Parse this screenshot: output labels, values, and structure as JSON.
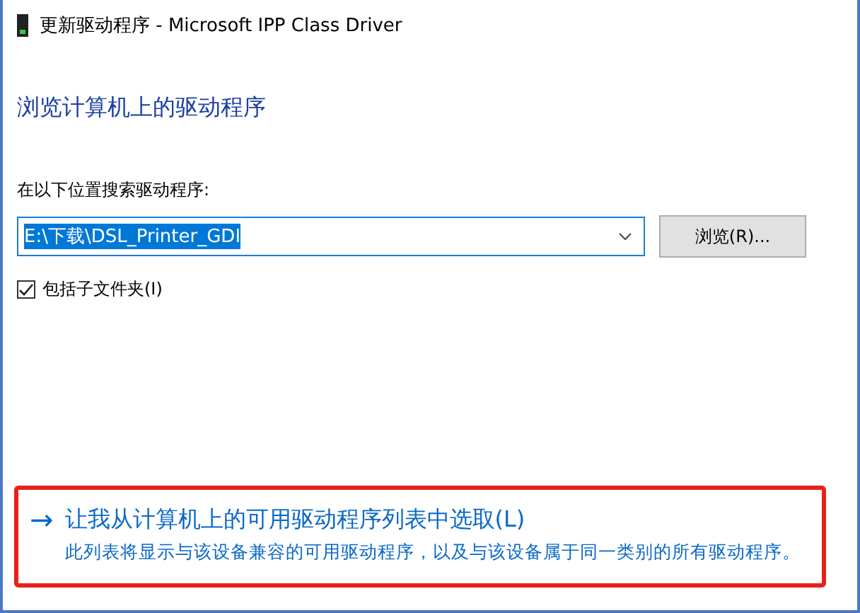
{
  "window": {
    "title": "更新驱动程序 - Microsoft IPP Class Driver"
  },
  "heading": "浏览计算机上的驱动程序",
  "search_label": "在以下位置搜索驱动程序:",
  "path_field": {
    "value": "E:\\下载\\DSL_Printer_GDI",
    "selected": true
  },
  "browse_button": "浏览(R)...",
  "include_subfolders": {
    "label": "包括子文件夹(I)",
    "checked": true
  },
  "pick_option": {
    "arrow": "→",
    "title": "让我从计算机上的可用驱动程序列表中选取(L)",
    "description": "此列表将显示与该设备兼容的可用驱动程序，以及与该设备属于同一类别的所有驱动程序。",
    "highlighted": true
  }
}
